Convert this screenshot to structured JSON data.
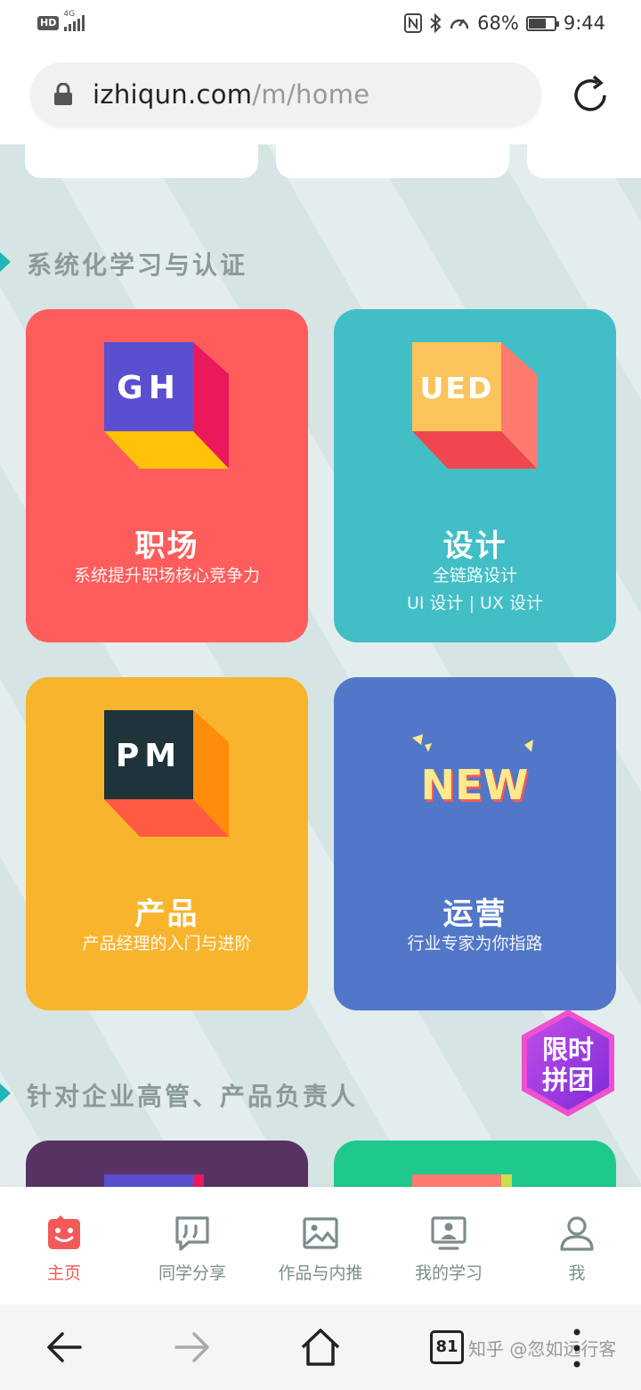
{
  "status_bar": {
    "hd": "HD",
    "network": "4G",
    "battery": "68%",
    "battery_level": 0.68,
    "time": "9:44"
  },
  "browser": {
    "url_domain": "izhiqun.com",
    "url_path": "/m/home",
    "tab_count": "81"
  },
  "sections": [
    {
      "title": "系统化学习与认证"
    },
    {
      "title": "针对企业高管、产品负责人"
    }
  ],
  "cards": [
    {
      "icon_text": "GH",
      "title": "职场",
      "sub1": "系统提升职场核心竞争力",
      "sub2": "",
      "color": "#ff5c5c"
    },
    {
      "icon_text": "UED",
      "title": "设计",
      "sub1": "全链路设计",
      "sub2": "UI 设计 | UX 设计",
      "color": "#42bec6"
    },
    {
      "icon_text": "PM",
      "title": "产品",
      "sub1": "产品经理的入门与进阶",
      "sub2": "",
      "color": "#f8b42c"
    },
    {
      "icon_text": "NEW",
      "title": "运营",
      "sub1": "行业专家为你指路",
      "sub2": "",
      "color": "#5277c8"
    }
  ],
  "promo": {
    "line1": "限时",
    "line2": "拼团"
  },
  "nav": [
    {
      "label": "主页",
      "icon": "home-face-icon",
      "active": true
    },
    {
      "label": "同学分享",
      "icon": "chat-quote-icon",
      "active": false
    },
    {
      "label": "作品与内推",
      "icon": "image-icon",
      "active": false
    },
    {
      "label": "我的学习",
      "icon": "monitor-user-icon",
      "active": false
    },
    {
      "label": "我",
      "icon": "user-icon",
      "active": false
    }
  ],
  "watermark": "知乎 @忽如远行客",
  "colors": {
    "accent": "#f25a5a",
    "teal_marker": "#21b5b5",
    "background": "#d6e4e4"
  }
}
